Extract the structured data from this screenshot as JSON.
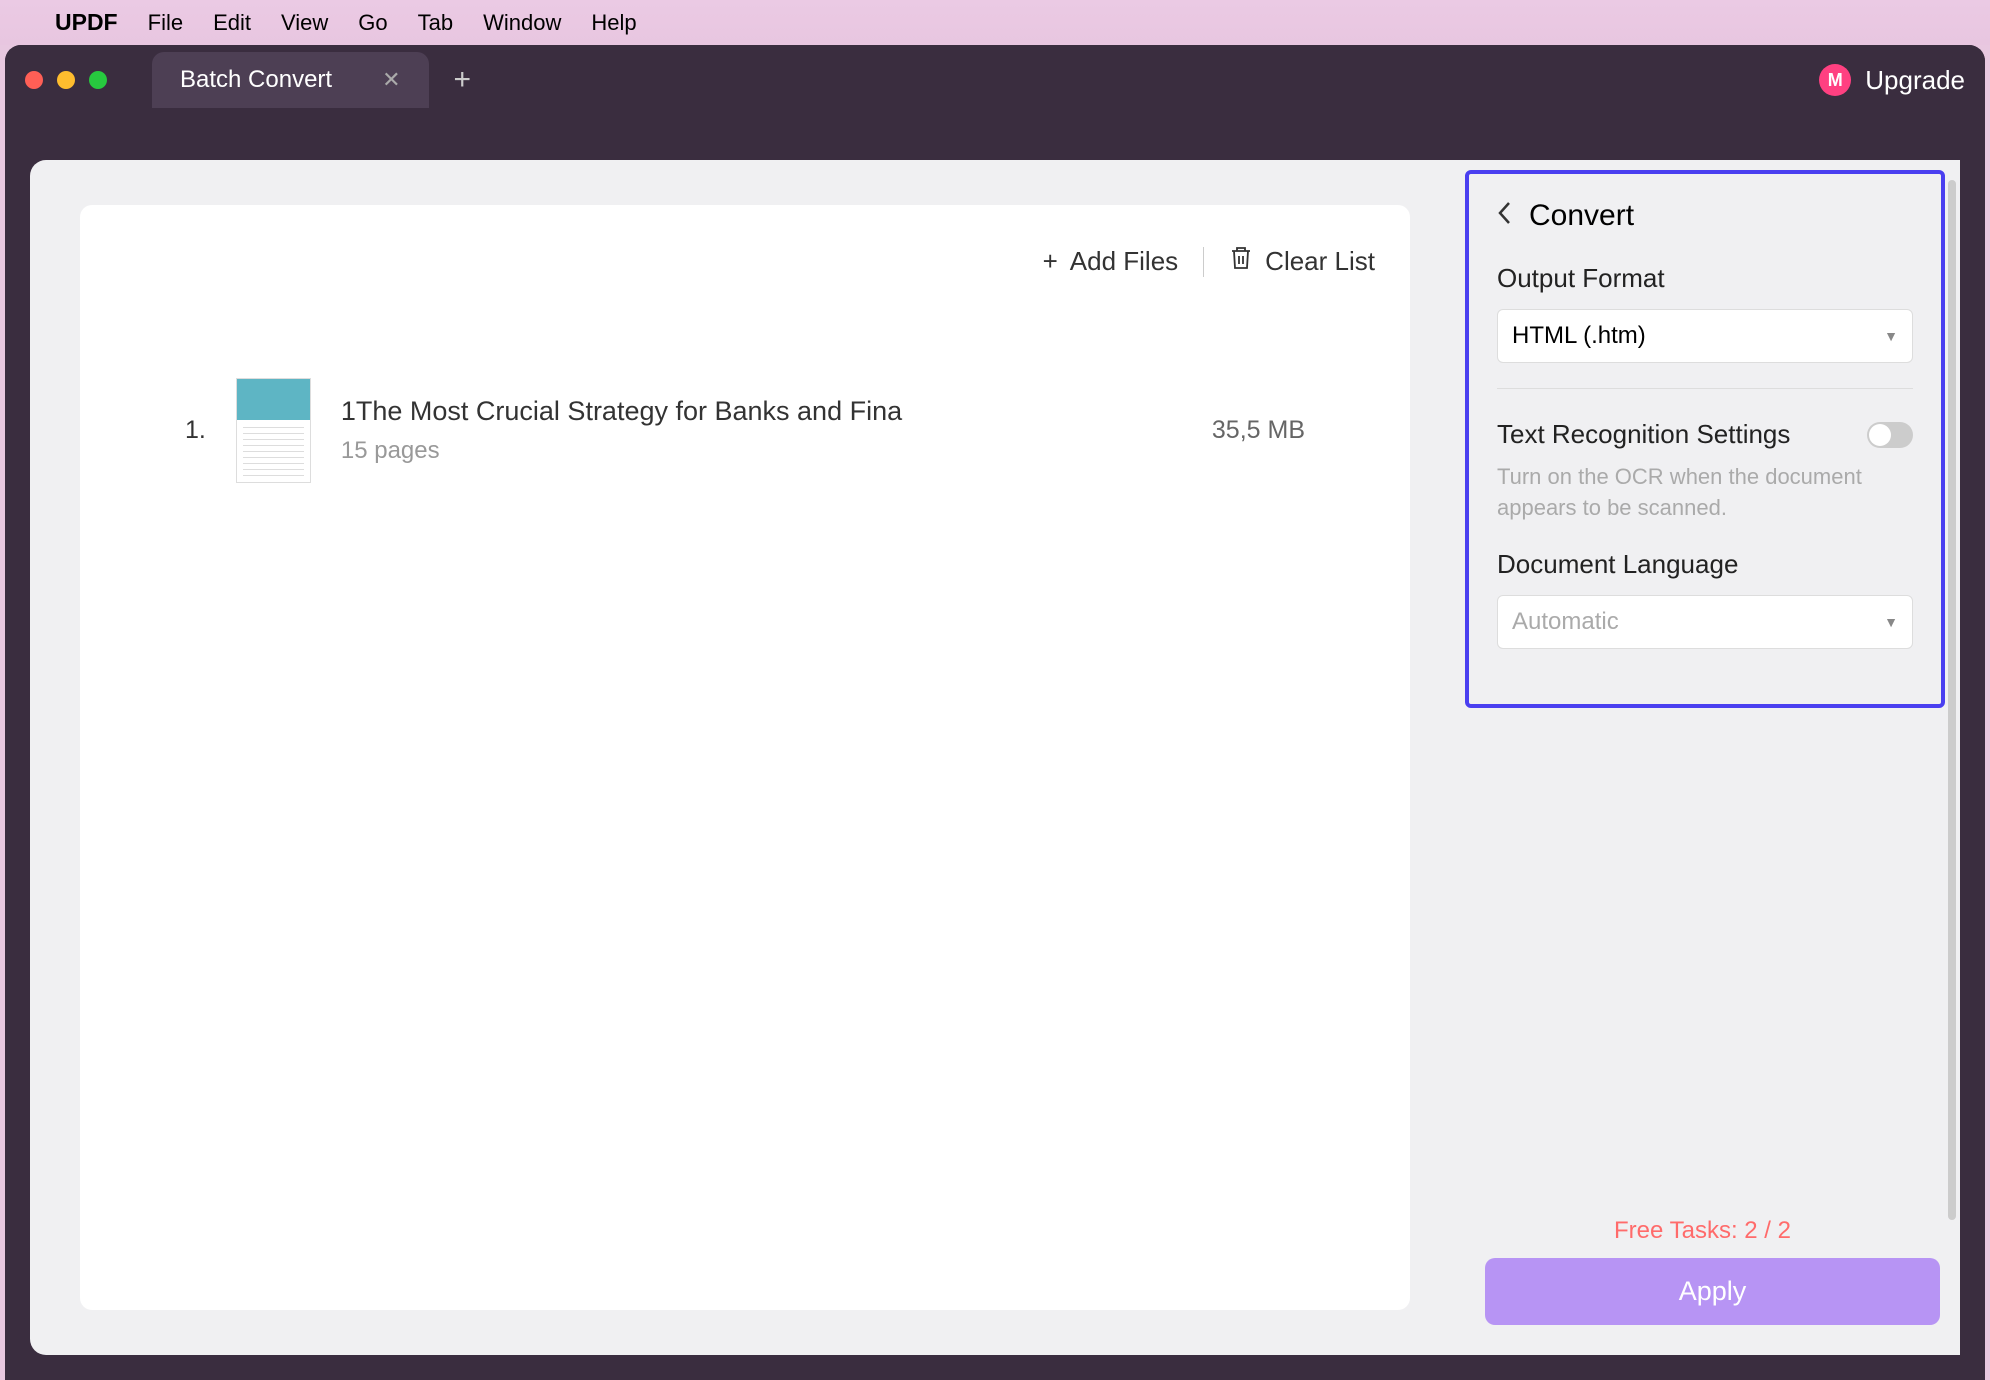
{
  "menubar": {
    "app": "UPDF",
    "items": [
      "File",
      "Edit",
      "View",
      "Go",
      "Tab",
      "Window",
      "Help"
    ]
  },
  "window": {
    "tab_name": "Batch Convert",
    "upgrade_label": "Upgrade",
    "avatar_letter": "M"
  },
  "toolbar": {
    "add_files": "Add Files",
    "clear_list": "Clear List"
  },
  "files": [
    {
      "index": "1.",
      "title": "1The Most Crucial Strategy for Banks and Fina",
      "pages": "15 pages",
      "size": "35,5 MB"
    }
  ],
  "convert_panel": {
    "title": "Convert",
    "output_format_label": "Output Format",
    "output_format_value": "HTML (.htm)",
    "ocr_label": "Text Recognition Settings",
    "ocr_description": "Turn on the OCR when the document appears to be scanned.",
    "language_label": "Document Language",
    "language_value": "Automatic"
  },
  "footer": {
    "free_tasks": "Free Tasks: 2 / 2",
    "apply": "Apply"
  }
}
